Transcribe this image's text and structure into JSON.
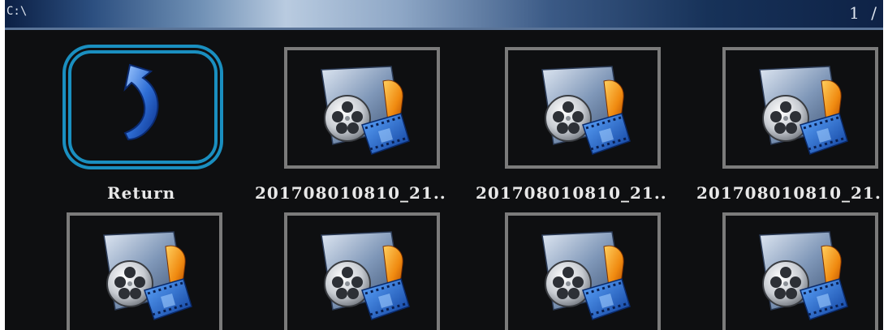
{
  "header": {
    "path": "C:\\",
    "page": "1 /"
  },
  "items": [
    {
      "label": "Return",
      "icon": "return-arrow-icon",
      "selected": true
    },
    {
      "label": "201708010810_21..",
      "icon": "video-file-icon",
      "selected": false
    },
    {
      "label": "201708010810_21..",
      "icon": "video-file-icon",
      "selected": false
    },
    {
      "label": "201708010810_21.",
      "icon": "video-file-icon",
      "selected": false
    },
    {
      "label": "",
      "icon": "video-file-icon",
      "selected": false
    },
    {
      "label": "",
      "icon": "video-file-icon",
      "selected": false
    },
    {
      "label": "",
      "icon": "video-file-icon",
      "selected": false
    },
    {
      "label": "",
      "icon": "video-file-icon",
      "selected": false
    }
  ],
  "colors": {
    "selection": "#1a8fc0",
    "frame": "#7b7b7b",
    "background": "#0e0f11"
  }
}
